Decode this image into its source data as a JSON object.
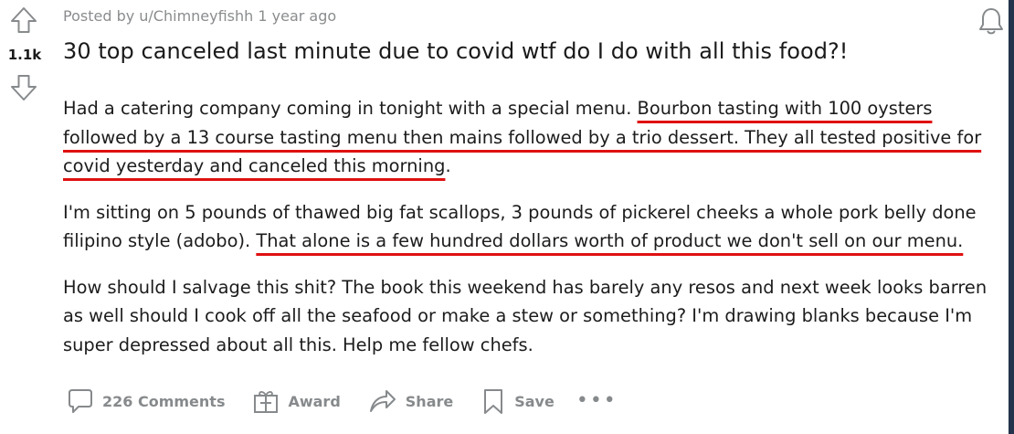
{
  "post": {
    "meta": "Posted by u/Chimneyfishh 1 year ago",
    "score": "1.1k",
    "title": "30 top canceled last minute due to covid wtf do I do with all this food?!",
    "body": {
      "p1": {
        "plain": "Had a catering company coming in tonight with a special menu. ",
        "highlight": "Bourbon tasting with 100 oysters followed by a 13 course tasting menu then mains followed by a trio dessert. They all tested positive for covid yesterday and canceled this morning",
        "end": "."
      },
      "p2": {
        "plain": "I'm sitting on 5 pounds of thawed big fat scallops, 3 pounds of pickerel cheeks a whole pork belly done filipino style (adobo). ",
        "highlight": "That alone is a few hundred dollars worth of product we don't sell on our menu."
      },
      "p3": "How should I salvage this shit? The book this weekend has barely any resos and next week looks barren as well should I cook off all the seafood or make a stew or something? I'm drawing blanks because I'm super depressed about all this. Help me fellow chefs."
    }
  },
  "actions": {
    "comments": "226 Comments",
    "award": "Award",
    "share": "Share",
    "save": "Save",
    "more": "•••"
  },
  "icons": [
    "upvote-arrow-icon",
    "downvote-arrow-icon",
    "notification-bell-icon",
    "comment-bubble-icon",
    "gift-icon",
    "share-arrow-icon",
    "bookmark-icon"
  ],
  "colors": {
    "annotation_underline": "#e01010",
    "muted_text": "#878a8c",
    "title_text": "#1a1a1b"
  }
}
